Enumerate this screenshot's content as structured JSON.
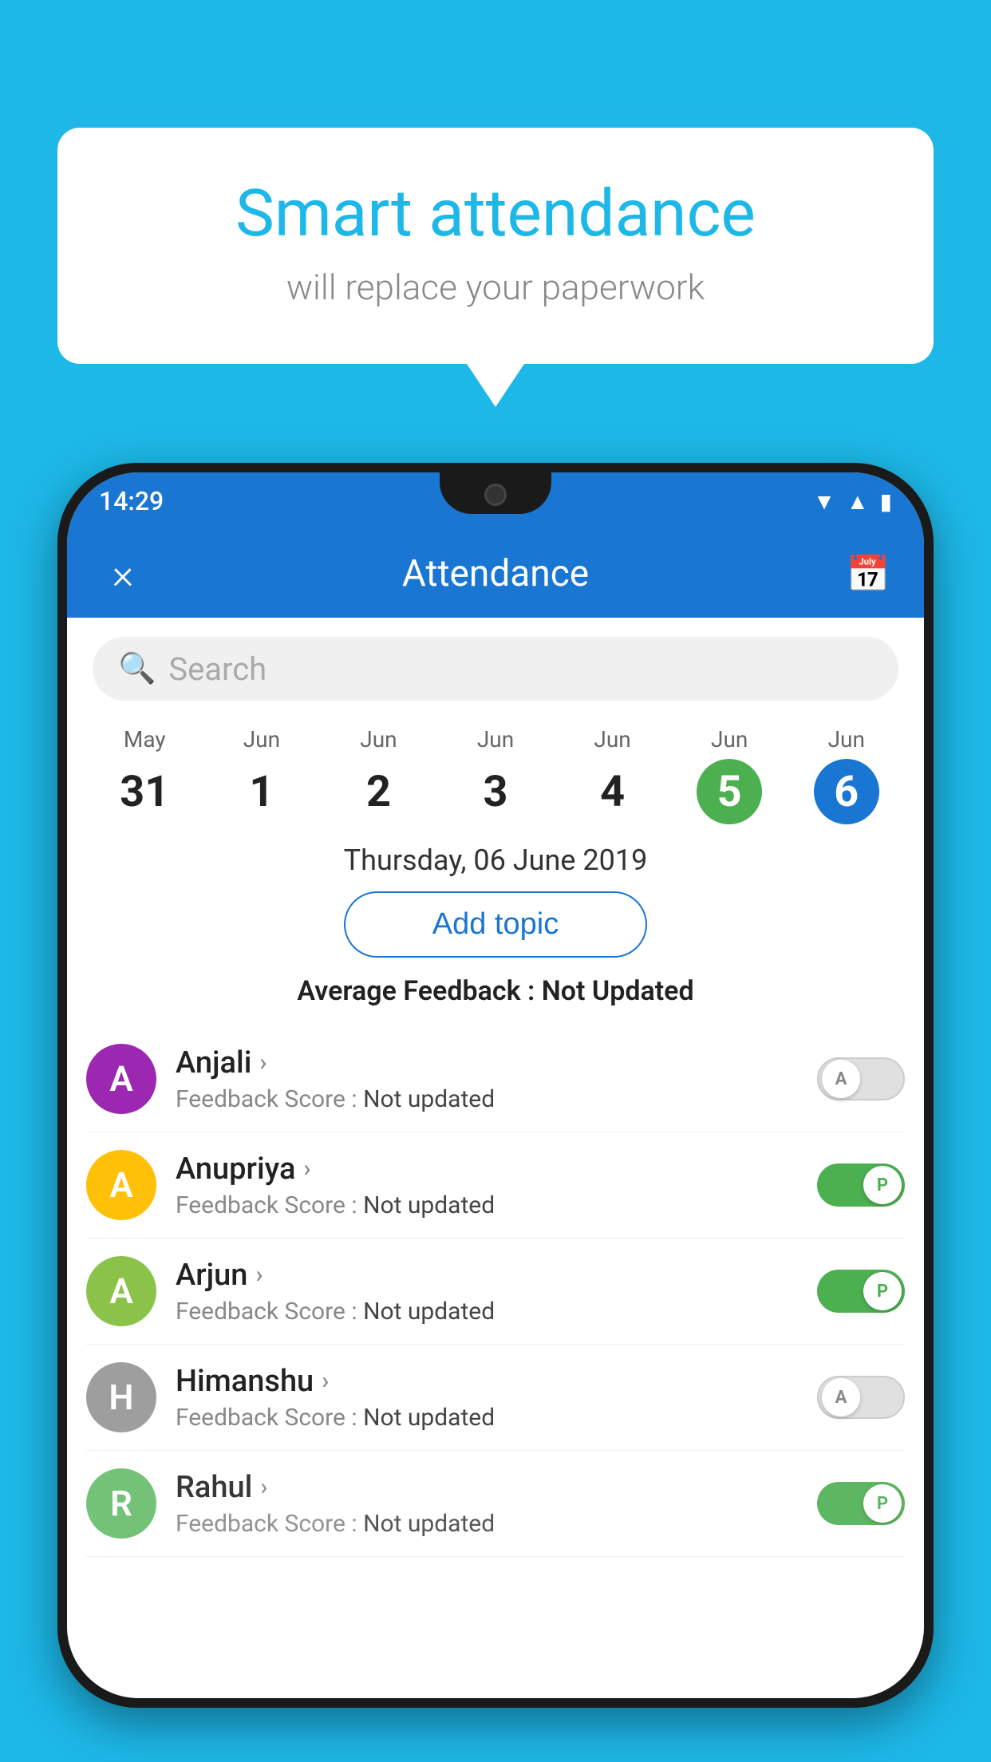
{
  "background_color": "#1DB8E8",
  "speech_bubble": {
    "title": "Smart attendance",
    "subtitle": "will replace your paperwork"
  },
  "status_bar": {
    "time": "14:29",
    "icons": [
      "wifi",
      "signal",
      "battery"
    ]
  },
  "app_bar": {
    "title": "Attendance",
    "close_label": "×",
    "calendar_icon": "📅"
  },
  "search": {
    "placeholder": "Search"
  },
  "calendar": {
    "days": [
      {
        "month": "May",
        "num": "31",
        "state": "normal"
      },
      {
        "month": "Jun",
        "num": "1",
        "state": "normal"
      },
      {
        "month": "Jun",
        "num": "2",
        "state": "normal"
      },
      {
        "month": "Jun",
        "num": "3",
        "state": "normal"
      },
      {
        "month": "Jun",
        "num": "4",
        "state": "normal"
      },
      {
        "month": "Jun",
        "num": "5",
        "state": "today"
      },
      {
        "month": "Jun",
        "num": "6",
        "state": "selected"
      }
    ]
  },
  "selected_date": "Thursday, 06 June 2019",
  "add_topic_label": "Add topic",
  "average_feedback": {
    "label": "Average Feedback : ",
    "value": "Not Updated"
  },
  "students": [
    {
      "name": "Anjali",
      "avatar_letter": "A",
      "avatar_color": "#9C27B0",
      "feedback_label": "Feedback Score : ",
      "feedback_value": "Not updated",
      "toggle_state": "off",
      "toggle_label": "A"
    },
    {
      "name": "Anupriya",
      "avatar_letter": "A",
      "avatar_color": "#FFC107",
      "feedback_label": "Feedback Score : ",
      "feedback_value": "Not updated",
      "toggle_state": "on",
      "toggle_label": "P"
    },
    {
      "name": "Arjun",
      "avatar_letter": "A",
      "avatar_color": "#8BC34A",
      "feedback_label": "Feedback Score : ",
      "feedback_value": "Not updated",
      "toggle_state": "on",
      "toggle_label": "P"
    },
    {
      "name": "Himanshu",
      "avatar_letter": "H",
      "avatar_color": "#9E9E9E",
      "feedback_label": "Feedback Score : ",
      "feedback_value": "Not updated",
      "toggle_state": "off",
      "toggle_label": "A"
    },
    {
      "name": "Rahul",
      "avatar_letter": "R",
      "avatar_color": "#66BB6A",
      "feedback_label": "Feedback Score : ",
      "feedback_value": "Not updated",
      "toggle_state": "on",
      "toggle_label": "P"
    }
  ]
}
